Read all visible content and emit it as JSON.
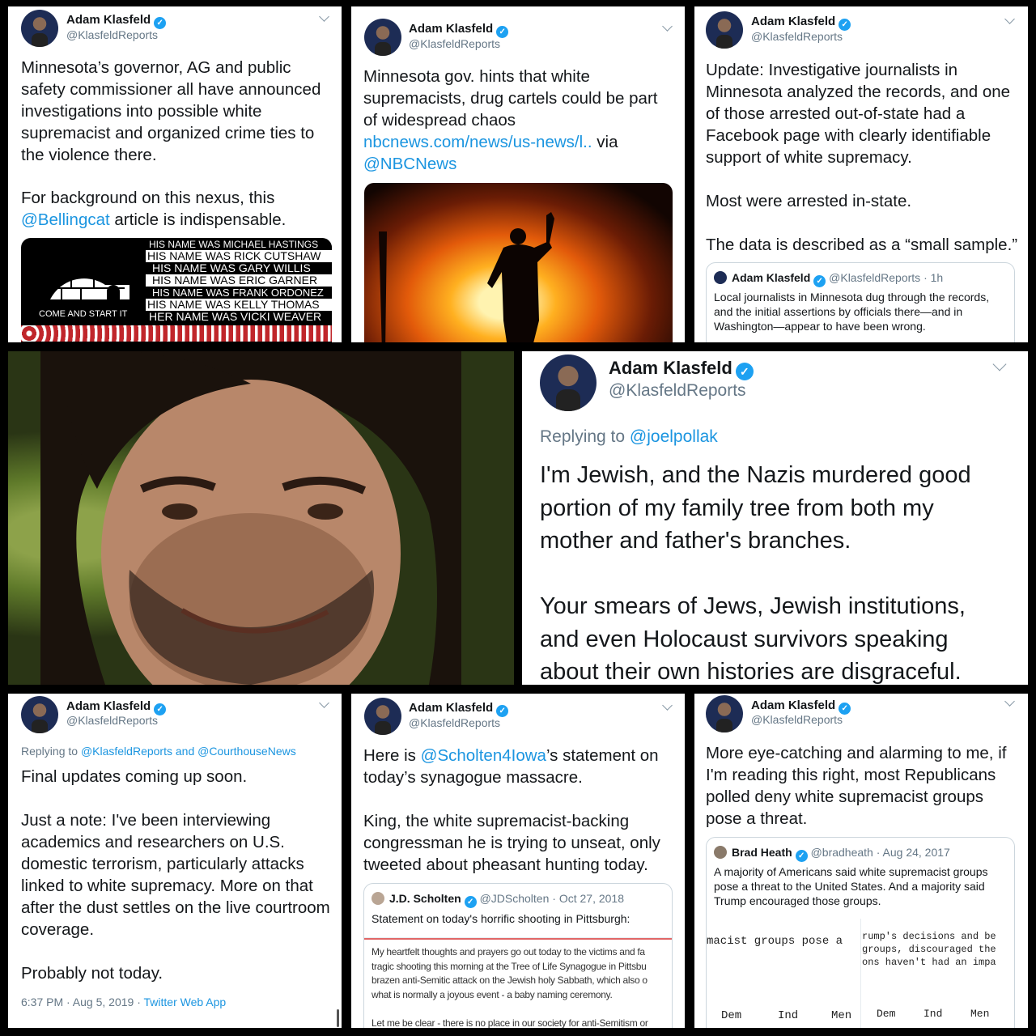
{
  "author": {
    "name": "Adam Klasfeld",
    "handle": "@KlasfeldReports",
    "verified_mark": "✓"
  },
  "tweets": {
    "t1": {
      "line1": "Minnesota’s governor, AG and public\nsafety commissioner all have announced\ninvestigations into possible white\nsupremacist and organized crime ties to\nthe violence there.",
      "line2": "For background on this nexus, this",
      "mention": "@Bellingcat",
      "line3": " article is indispensable.",
      "image": {
        "tagline": "COME AND START IT",
        "names": [
          "HIS NAME WAS MICHAEL HASTINGS",
          "HIS NAME WAS RICK CUTSHAW",
          "HIS NAME WAS GARY WILLIS",
          "HIS NAME WAS ERIC GARNER",
          "HIS NAME WAS FRANK ORDONEZ",
          "HIS NAME WAS KELLY THOMAS",
          "HER NAME WAS VICKI WEAVER"
        ]
      }
    },
    "t2": {
      "text": "Minnesota gov. hints that white\nsupremacists, drug cartels could be part\nof widespread chaos",
      "link": "nbcnews.com/news/us-news/l..",
      "via": " via",
      "mention": "@NBCNews"
    },
    "t3": {
      "text": "Update: Investigative journalists in\nMinnesota analyzed the records, and one\nof those arrested out-of-state had a\nFacebook page with clearly identifiable\nsupport of white supremacy.\n\nMost were arrested in-state.\n\nThe data is described as a “small sample.”",
      "quote": {
        "name": "Adam Klasfeld",
        "meta": "@KlasfeldReports · 1h",
        "text": "Local journalists in Minnesota dug through the records,\nand the initial assertions by officials there—and in\nWashington—appear to have been wrong."
      }
    },
    "t4": {
      "reply_prefix": "Replying to ",
      "reply_to": "@joelpollak",
      "text": "I'm Jewish, and the Nazis murdered good\nportion of my family tree from  both my\nmother and father's branches.\n\nYour smears of Jews, Jewish institutions,\nand even Holocaust survivors speaking\nabout their own histories are disgraceful."
    },
    "t5": {
      "reply_prefix": "Replying to ",
      "reply_to": "@KlasfeldReports and @CourthouseNews",
      "text": "Final updates coming up soon.\n\nJust a note: I've been interviewing\nacademics and researchers on U.S.\ndomestic terrorism, particularly attacks\nlinked to white supremacy. More on that\nafter the dust settles on the live courtroom\ncoverage.\n\nProbably not today.",
      "timestamp": "6:37 PM · Aug 5, 2019 · ",
      "source": "Twitter Web App"
    },
    "t6": {
      "pre": "Here is ",
      "mention": "@Scholten4Iowa",
      "post": "’s statement on\ntoday’s synagogue massacre.\n\nKing, the white supremacist-backing\ncongressman he is trying to unseat, only\ntweeted about pheasant hunting today.",
      "quote": {
        "name": "J.D. Scholten",
        "meta": "@JDScholten · Oct 27, 2018",
        "text": "Statement on today's horrific shooting in Pittsburgh:",
        "statement": "My heartfelt thoughts and prayers go out today to the victims and fa\ntragic shooting this morning at the Tree of Life Synagogue in Pittsbu\nbrazen anti-Semitic attack on the Jewish holy Sabbath, which also o\nwhat is normally a joyous event - a baby naming ceremony.\n\nLet me be clear - there is no place in our society for anti-Semitism or"
      }
    },
    "t7": {
      "text": "More eye-catching and alarming to me, if\nI'm reading this right, most Republicans\npolled deny white supremacist groups\npose a threat.",
      "quote": {
        "name": "Brad Heath",
        "meta": "@bradheath · Aug 24, 2017",
        "text": "A majority of Americans said white supremacist groups\npose a threat to the United States. And a majority said\nTrump encouraged those groups.",
        "img_left": "macist groups pose a",
        "img_right": "rump's decisions and be\ngroups, discouraged the\nons haven't had an impa",
        "axis": [
          "Dem",
          "Ind",
          "Men",
          "Dem",
          "Ind",
          "Men"
        ]
      }
    }
  }
}
